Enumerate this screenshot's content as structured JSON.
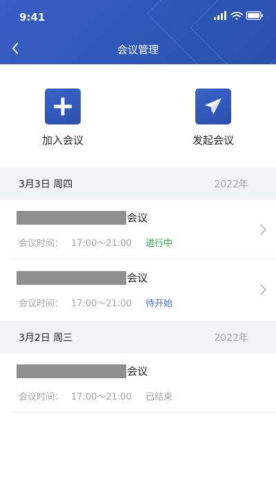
{
  "status_bar": {
    "time": "9:41"
  },
  "nav": {
    "title": "会议管理"
  },
  "actions": [
    {
      "label": "加入会议",
      "icon": "plus-icon"
    },
    {
      "label": "发起会议",
      "icon": "paper-plane-icon"
    }
  ],
  "groups": [
    {
      "date": "3月3日 周四",
      "year": "2022年",
      "meetings": [
        {
          "title_suffix": "会议",
          "time_label": "会议时间：",
          "time": "17:00～21:00",
          "status": "进行中",
          "status_color": "#2aa846",
          "has_chevron": true
        },
        {
          "title_suffix": "会议",
          "time_label": "会议时间：",
          "time": "17:00～21:00",
          "status": "待开始",
          "status_color": "#3b73d6",
          "has_chevron": true
        }
      ]
    },
    {
      "date": "3月2日 周三",
      "year": "2022年",
      "meetings": [
        {
          "title_suffix": "会议",
          "time_label": "会议时间：",
          "time": "17:00～21:00",
          "status": "已结束",
          "status_color": "#a6a6a6",
          "has_chevron": false
        }
      ]
    }
  ],
  "colors": {
    "header": "#2e57b8",
    "accent": "#3b5fc2"
  }
}
